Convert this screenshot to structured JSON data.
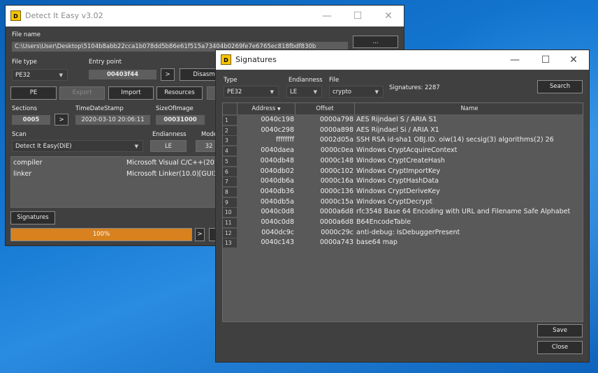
{
  "die": {
    "title": "Detect It Easy v3.02",
    "controls": {
      "min": "—",
      "max": "☐",
      "close": "✕"
    },
    "file_name_label": "File name",
    "file_path": "C:\\Users\\User\\Desktop\\5104b8abb22cca1b078dd5b86e61f515a73404b0269fe7e6765ec818fbdf830b",
    "browse_label": "...",
    "file_type_label": "File type",
    "file_type_value": "PE32",
    "entry_point_label": "Entry point",
    "entry_point_value": "00403f44",
    "entry_go": ">",
    "disasm_label": "Disasm",
    "pe_button": "PE",
    "export_button": "Export",
    "import_button": "Import",
    "resources_button": "Resources",
    "sections_label": "Sections",
    "sections_value": "0005",
    "sections_go": ">",
    "timedatestamp_label": "TimeDateStamp",
    "timedatestamp_value": "2020-03-10 20:06:11",
    "sizeofimage_label": "SizeOfImage",
    "sizeofimage_value": "00031000",
    "scan_label": "Scan",
    "scan_value": "Detect It Easy(DiE)",
    "endianness_label": "Endianness",
    "endianness_value": "LE",
    "mode_label": "Mode",
    "mode_value": "32",
    "scan_results": [
      {
        "key": "compiler",
        "value": "Microsoft Visual C/C++(2015"
      },
      {
        "key": "linker",
        "value": "Microsoft Linker(10.0)[GUI32"
      }
    ],
    "signatures_button": "Signatures",
    "progress_text": "100%",
    "progress_value": 1.0,
    "progress_go": ">"
  },
  "sig": {
    "title": "Signatures",
    "controls": {
      "min": "—",
      "max": "☐",
      "close": "✕"
    },
    "type_label": "Type",
    "type_value": "PE32",
    "endianness_label": "Endianness",
    "endianness_value": "LE",
    "file_label": "File",
    "file_value": "crypto",
    "signatures_count": "Signatures: 2287",
    "search_button": "Search",
    "columns": {
      "address": "Address",
      "offset": "Offset",
      "name": "Name"
    },
    "rows": [
      {
        "idx": "1",
        "address": "0040c198",
        "offset": "0000a798",
        "name": "AES Rijndael S / ARIA S1"
      },
      {
        "idx": "2",
        "address": "0040c298",
        "offset": "0000a898",
        "name": "AES Rijndael Si / ARIA X1"
      },
      {
        "idx": "3",
        "address": "ffffffff",
        "offset": "0002d05a",
        "name": "SSH RSA id-sha1 OBJ.ID. oiw(14) secsig(3) algorithms(2) 26"
      },
      {
        "idx": "4",
        "address": "0040daea",
        "offset": "0000c0ea",
        "name": "Windows CryptAcquireContext"
      },
      {
        "idx": "5",
        "address": "0040db48",
        "offset": "0000c148",
        "name": "Windows CryptCreateHash"
      },
      {
        "idx": "6",
        "address": "0040db02",
        "offset": "0000c102",
        "name": "Windows CryptImportKey"
      },
      {
        "idx": "7",
        "address": "0040db6a",
        "offset": "0000c16a",
        "name": "Windows CryptHashData"
      },
      {
        "idx": "8",
        "address": "0040db36",
        "offset": "0000c136",
        "name": "Windows CryptDeriveKey"
      },
      {
        "idx": "9",
        "address": "0040db5a",
        "offset": "0000c15a",
        "name": "Windows CryptDecrypt"
      },
      {
        "idx": "10",
        "address": "0040c0d8",
        "offset": "0000a6d8",
        "name": "rfc3548 Base 64 Encoding with URL and Filename Safe Alphabet"
      },
      {
        "idx": "11",
        "address": "0040c0d8",
        "offset": "0000a6d8",
        "name": "B64EncodeTable"
      },
      {
        "idx": "12",
        "address": "0040dc9c",
        "offset": "0000c29c",
        "name": "anti-debug: IsDebuggerPresent"
      },
      {
        "idx": "13",
        "address": "0040c143",
        "offset": "0000a743",
        "name": "base64 map"
      }
    ],
    "save_button": "Save",
    "close_button": "Close"
  }
}
